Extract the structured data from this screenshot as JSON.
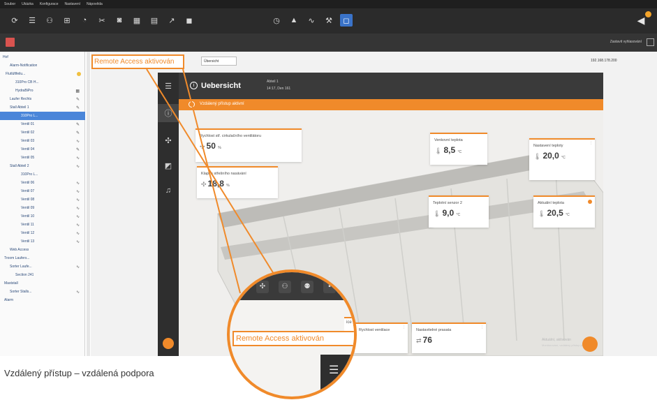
{
  "menubar": {
    "items": [
      "Soubor",
      "Ukázka",
      "Konfigurace",
      "Nastavení",
      "Nápověda"
    ]
  },
  "toolbar": {
    "buttons": [
      {
        "icon": "refresh-icon",
        "glyph": "⟳"
      },
      {
        "icon": "list-icon",
        "glyph": "☰"
      },
      {
        "icon": "users-icon",
        "glyph": "⚇"
      },
      {
        "icon": "tree-icon",
        "glyph": "⊞"
      },
      {
        "icon": "gauge-icon",
        "glyph": "◔"
      },
      {
        "icon": "scissors-icon",
        "glyph": "✂"
      },
      {
        "icon": "camera-icon",
        "glyph": "◙"
      },
      {
        "icon": "calendar-icon",
        "glyph": "▦"
      },
      {
        "icon": "report-icon",
        "glyph": "▤"
      },
      {
        "icon": "chart-icon",
        "glyph": "↗"
      },
      {
        "icon": "chat-icon",
        "glyph": "◼"
      },
      {
        "icon": "clock-icon",
        "glyph": "◷"
      },
      {
        "icon": "alarm-icon",
        "glyph": "▲"
      },
      {
        "icon": "graph-icon",
        "glyph": "∿"
      },
      {
        "icon": "tools-icon",
        "glyph": "⚒"
      },
      {
        "icon": "window-icon",
        "glyph": "◻"
      }
    ],
    "right_icon": "megaphone-icon",
    "right_glyph": "◀"
  },
  "subbar": {
    "right_text": "Zastavit vyhlasování"
  },
  "tree": {
    "items": [
      {
        "label": "Hof",
        "indent": 0,
        "marker": ""
      },
      {
        "label": "Alarm-Notification",
        "indent": 1,
        "marker": ""
      },
      {
        "label": "Flutlüftfeilu...",
        "indent": 1,
        "marker": "gear"
      },
      {
        "label": "310Pro CB H...",
        "indent": 2,
        "marker": ""
      },
      {
        "label": "HydraBiPro",
        "indent": 2,
        "marker": "▦"
      },
      {
        "label": "Laufer Rechts",
        "indent": 1,
        "marker": "✎"
      },
      {
        "label": "Stall Abteil 1",
        "indent": 1,
        "marker": "✎"
      },
      {
        "label": "310Pro L...",
        "indent": 2,
        "marker": "",
        "selected": true
      },
      {
        "label": "Ventil 01",
        "indent": 2,
        "marker": "✎"
      },
      {
        "label": "Ventil 02",
        "indent": 2,
        "marker": "✎"
      },
      {
        "label": "Ventil 03",
        "indent": 2,
        "marker": "∿"
      },
      {
        "label": "Ventil 04",
        "indent": 2,
        "marker": "✎"
      },
      {
        "label": "Ventil 05",
        "indent": 2,
        "marker": "∿"
      },
      {
        "label": "Stall Abteil 2",
        "indent": 1,
        "marker": "∿"
      },
      {
        "label": "310Pro L...",
        "indent": 2,
        "marker": ""
      },
      {
        "label": "Ventil 06",
        "indent": 2,
        "marker": "∿"
      },
      {
        "label": "Ventil 07",
        "indent": 2,
        "marker": "∿"
      },
      {
        "label": "Ventil 08",
        "indent": 2,
        "marker": "∿"
      },
      {
        "label": "Ventil 09",
        "indent": 2,
        "marker": "∿"
      },
      {
        "label": "Ventil 10",
        "indent": 2,
        "marker": "∿"
      },
      {
        "label": "Ventil 11",
        "indent": 2,
        "marker": "∿"
      },
      {
        "label": "Ventil 12",
        "indent": 2,
        "marker": "∿"
      },
      {
        "label": "Ventil 13",
        "indent": 2,
        "marker": "∿"
      },
      {
        "label": "Web Access",
        "indent": 1,
        "marker": ""
      },
      {
        "label": "Troom Laufers...",
        "indent": 0,
        "marker": ""
      },
      {
        "label": "Sorter Laufe...",
        "indent": 1,
        "marker": "∿"
      },
      {
        "label": "Section 241",
        "indent": 2,
        "marker": ""
      },
      {
        "label": "Maststall",
        "indent": 0,
        "marker": ""
      },
      {
        "label": "Sorter Stalls...",
        "indent": 1,
        "marker": "∿"
      },
      {
        "label": "Alarm",
        "indent": 0,
        "marker": ""
      }
    ]
  },
  "main": {
    "remote_label": "Remote Access aktivován",
    "overview_button": "Übersicht",
    "ip": "192.168.178.200"
  },
  "app": {
    "title": "Uebersicht",
    "subtitle1": "Abteil 1",
    "subtitle2": "14:17, Den 161",
    "banner": "Vzdálený přístup aktivní",
    "rail_icons": [
      {
        "name": "menu-icon",
        "glyph": "☰"
      },
      {
        "name": "info-icon",
        "glyph": "ⓘ"
      },
      {
        "name": "fan-icon",
        "glyph": "✣"
      },
      {
        "name": "chart-icon",
        "glyph": "◩"
      },
      {
        "name": "bell-icon",
        "glyph": "♫"
      }
    ],
    "cards": [
      {
        "title": "Rychlost stř. cirkulačního ventilátoru",
        "value": "50",
        "unit": "%",
        "icon": "✣"
      },
      {
        "title": "Klapka střešního nasávání",
        "value": "18,8",
        "unit": "%",
        "icon": "✣"
      },
      {
        "title": "Venkovní teplota",
        "value": "8,5",
        "unit": "°C",
        "icon": "🌡"
      },
      {
        "title": "Nastavení teploty",
        "value": "20,0",
        "unit": "°C",
        "icon": "🌡"
      },
      {
        "title": "Teplotní senzor 2",
        "value": "9,0",
        "unit": "°C",
        "icon": "🌡"
      },
      {
        "title": "Aktuální teplota",
        "value": "20,5",
        "unit": "°C",
        "icon": "🌡"
      },
      {
        "title": "Rychlost ventilace",
        "value": "",
        "unit": "",
        "icon": ""
      },
      {
        "title": "Nastavitelné prasata",
        "value": "76",
        "unit": "",
        "icon": "⇄"
      }
    ],
    "ghost_title": "Aktuální, aktivován",
    "ghost_sub": "Monitorování, vzdálený přístup je aktivován"
  },
  "magnifier": {
    "remote_label": "Remote Access aktivován",
    "card_text": "ice ventilace"
  },
  "caption": "Vzdálený přístup – vzdálená podpora",
  "colors": {
    "accent": "#f08a2a",
    "dark": "#2e2e2e",
    "selection": "#4a86d9"
  }
}
